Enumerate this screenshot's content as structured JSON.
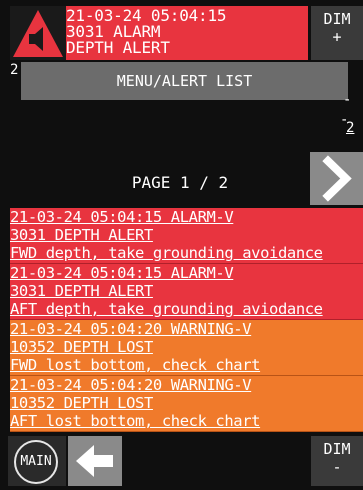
{
  "alarm_banner": {
    "timestamp": "21-03-24 05:04:15",
    "code_type": "3031 ALARM",
    "message": "DEPTH ALERT"
  },
  "dim_plus": {
    "label": "DIM",
    "sign": "+"
  },
  "dim_minus": {
    "label": "DIM",
    "sign": "-"
  },
  "menu_bar": {
    "title": "MENU/ALERT LIST"
  },
  "background_values": {
    "left_2": "2",
    "right_dash_1": "-",
    "right_dash_2": "-",
    "right_2": "2"
  },
  "pagination": {
    "label": "PAGE 1 / 2"
  },
  "alerts": [
    {
      "line1": "21-03-24 05:04:15 ALARM-V",
      "line2": "3031 DEPTH ALERT",
      "line3": "FWD depth, take grounding avoidance",
      "severity": "alarm"
    },
    {
      "line1": "21-03-24 05:04:15 ALARM-V",
      "line2": "3031 DEPTH ALERT",
      "line3": "AFT depth, take grounding aviodance",
      "severity": "alarm"
    },
    {
      "line1": "21-03-24 05:04:20 WARNING-V",
      "line2": "10352 DEPTH LOST",
      "line3": "FWD lost bottom, check chart",
      "severity": "warning"
    },
    {
      "line1": "21-03-24 05:04:20 WARNING-V",
      "line2": "10352 DEPTH LOST",
      "line3": "AFT lost bottom, check chart",
      "severity": "warning"
    }
  ],
  "main_button": {
    "label": "MAIN"
  },
  "colors": {
    "alarm": "#e8343f",
    "warning": "#f07a2b",
    "menu_bar": "#6c6c6c",
    "button": "#8a8a8a"
  },
  "icons": {
    "alarm": "triangle-speaker-icon",
    "next": "chevron-right-icon",
    "back": "arrow-left-icon"
  }
}
